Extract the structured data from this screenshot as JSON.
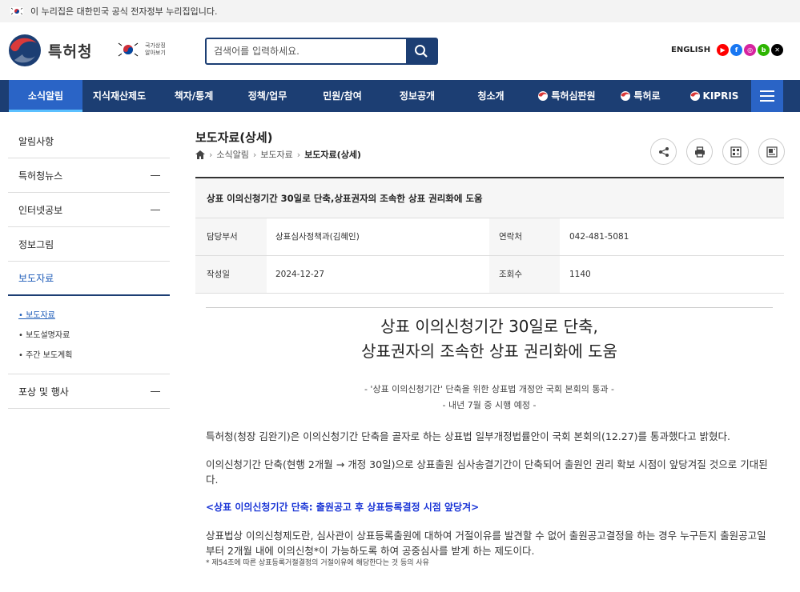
{
  "gov_banner": {
    "text": "이 누리집은 대한민국 공식 전자정부 누리집입니다."
  },
  "header": {
    "logo_text": "특허청",
    "symbol_label": "국가상징 알아보기",
    "search_placeholder": "검색어를 입력하세요.",
    "english_label": "ENGLISH",
    "sns": [
      "youtube-icon",
      "facebook-icon",
      "instagram-icon",
      "blog-icon",
      "x-icon"
    ]
  },
  "nav": {
    "items": [
      "소식알림",
      "지식재산제도",
      "책자/통계",
      "정책/업무",
      "민원/참여",
      "정보공개",
      "청소개",
      "특허심판원",
      "특허로",
      "KIPRIS"
    ]
  },
  "sidebar": {
    "items": [
      "알림사항",
      "특허청뉴스",
      "인터넷공보",
      "정보그림",
      "보도자료"
    ],
    "subitems": [
      "보도자료",
      "보도설명자료",
      "주간 보도계획"
    ],
    "last_item": "포상 및 행사"
  },
  "page": {
    "title": "보도자료(상세)",
    "breadcrumb": [
      "소식알림",
      "보도자료",
      "보도자료(상세)"
    ]
  },
  "detail": {
    "heading": "상표 이의신청기간 30일로 단축,상표권자의 조속한 상표 권리화에 도움",
    "dept_label": "담당부서",
    "dept_value": "상표심사정책과(김혜인)",
    "contact_label": "연락처",
    "contact_value": "042-481-5081",
    "date_label": "작성일",
    "date_value": "2024-12-27",
    "views_label": "조회수",
    "views_value": "1140"
  },
  "article": {
    "title_line1": "상표 이의신청기간 30일로 단축,",
    "title_line2": "상표권자의 조속한 상표 권리화에 도움",
    "subtitle_line1": "- '상표 이의신청기간' 단축을 위한 상표법 개정안 국회 본회의 통과 -",
    "subtitle_line2": "- 내년 7월 중 시행 예정 -",
    "para1": "특허청(청장 김완기)은 이의신청기간 단축을 골자로 하는 상표법 일부개정법률안이 국회 본회의(12.27)를 통과했다고 밝혔다.",
    "para2": "이의신청기간 단축(현행 2개월 → 개정 30일)으로 상표출원 심사송결기간이 단축되어 출원인 권리 확보 시점이 앞당겨질 것으로 기대된다.",
    "lead": "<상표 이의신청기간 단축: 출원공고 후 상표등록결정 시점 앞당겨>",
    "para3": "상표법상 이의신청제도란, 심사관이 상표등록출원에 대하여 거절이유를 발견할 수 없어 출원공고결정을 하는 경우 누구든지 출원공고일부터 2개월 내에 이의신청*이 가능하도록 하여 공중심사를 받게 하는 제도이다.",
    "note": "* 제54조에 따른 상표등록거절결정의 거절이유에 해당한다는 것 등의 사유"
  }
}
